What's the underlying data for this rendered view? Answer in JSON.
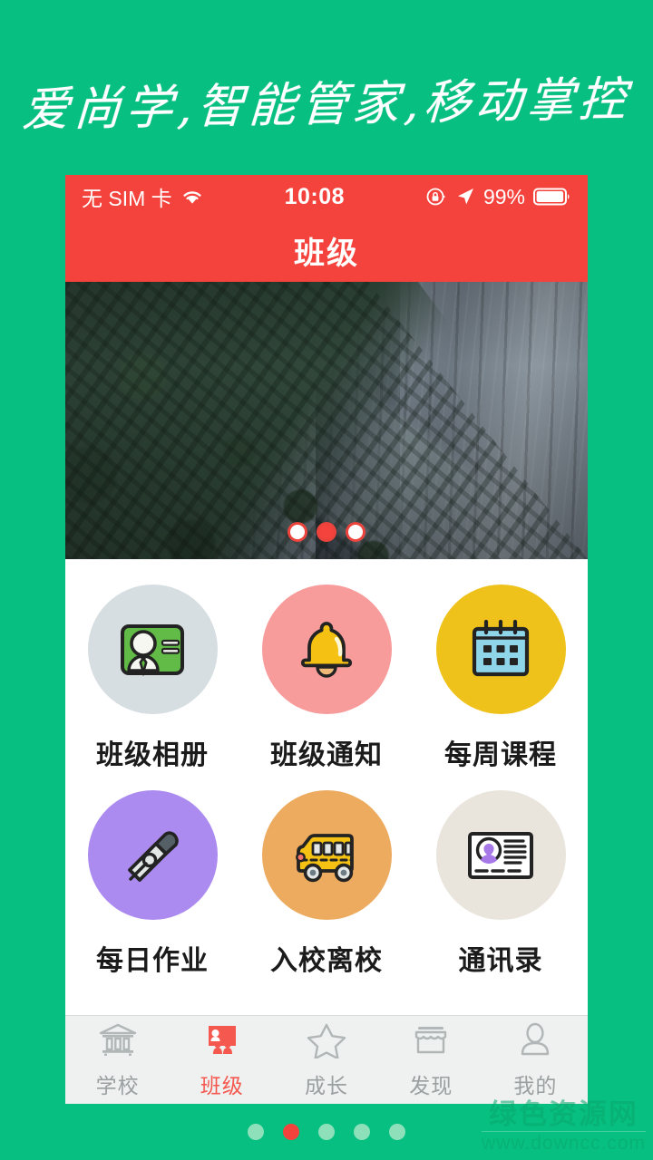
{
  "page": {
    "background_color": "#06bf80",
    "headline": "爱尚学,智能管家,移动掌控"
  },
  "phone": {
    "status_bar": {
      "carrier": "无 SIM 卡",
      "wifi_icon": "wifi-icon",
      "time": "10:08",
      "rotation_lock_icon": "rotation-lock-icon",
      "location_icon": "location-arrow-icon",
      "battery_percent": "99%",
      "battery_icon": "battery-icon",
      "background_color": "#f4433c"
    },
    "nav_bar": {
      "title": "班级",
      "background_color": "#f4433c"
    },
    "banner": {
      "image_name": "yosemite-cliff-photo",
      "dots": [
        {
          "active": false
        },
        {
          "active": true
        },
        {
          "active": false
        }
      ],
      "active_color": "#f4433c"
    },
    "grid": {
      "rows": [
        [
          {
            "label": "班级相册",
            "icon": "classroom-board-icon",
            "bubble_color": "#d7dee1"
          },
          {
            "label": "班级通知",
            "icon": "bell-icon",
            "bubble_color": "#f79b9b"
          },
          {
            "label": "每周课程",
            "icon": "calendar-icon",
            "bubble_color": "#eec21a"
          }
        ],
        [
          {
            "label": "每日作业",
            "icon": "fountain-pen-nib-icon",
            "bubble_color": "#ab8bf0"
          },
          {
            "label": "入校离校",
            "icon": "school-bus-icon",
            "bubble_color": "#edab60"
          },
          {
            "label": "通讯录",
            "icon": "contact-card-icon",
            "bubble_color": "#e9e4dc"
          }
        ]
      ]
    },
    "tab_bar": {
      "background_color": "#eff0f0",
      "active_color": "#f4584f",
      "inactive_color": "#9a9fa0",
      "tabs": [
        {
          "label": "学校",
          "icon": "bank-building-icon",
          "active": false
        },
        {
          "label": "班级",
          "icon": "classroom-people-icon",
          "active": true
        },
        {
          "label": "成长",
          "icon": "star-icon",
          "active": false
        },
        {
          "label": "发现",
          "icon": "storefront-icon",
          "active": false
        },
        {
          "label": "我的",
          "icon": "person-icon",
          "active": false
        }
      ]
    }
  },
  "page_dots": {
    "count": 5,
    "active_index": 1,
    "active_color": "#f4433c",
    "inactive_color": "#8ee0bb"
  },
  "watermark": {
    "title": "绿色资源网",
    "url": "www.downcc.com"
  }
}
